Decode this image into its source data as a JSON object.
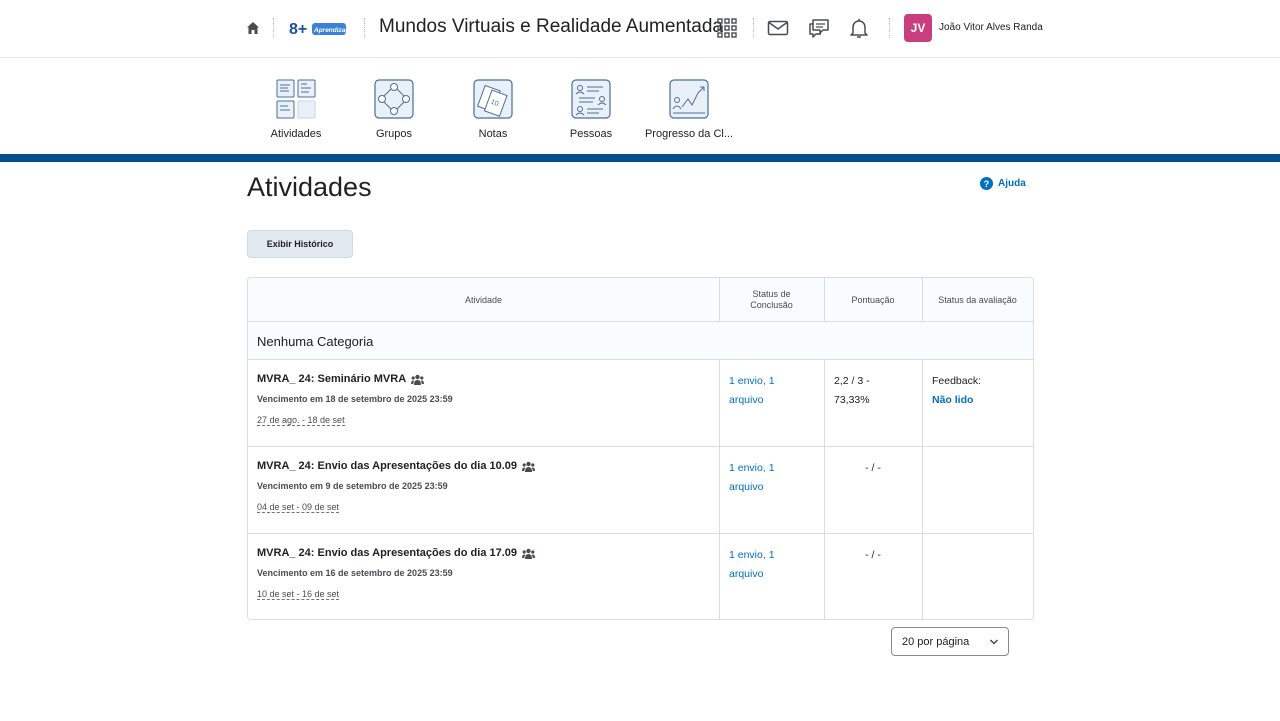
{
  "header": {
    "course_title": "Mundos Virtuais e Realidade Aumentada",
    "logo_text": "8+ Aprendizagem",
    "avatar_initials": "JV",
    "avatar_color": "#c83e7f",
    "user_name": "João Vitor Alves Randa",
    "icons": [
      "home-icon",
      "apps-grid-icon",
      "mail-icon",
      "chat-icon",
      "bell-icon"
    ]
  },
  "nav": {
    "items": [
      {
        "label": "Atividades",
        "icon": "activities-icon"
      },
      {
        "label": "Grupos",
        "icon": "groups-icon"
      },
      {
        "label": "Notas",
        "icon": "grades-icon"
      },
      {
        "label": "Pessoas",
        "icon": "people-icon"
      },
      {
        "label": "Progresso da Cl...",
        "icon": "progress-icon"
      }
    ]
  },
  "page": {
    "title": "Atividades",
    "help_label": "Ajuda",
    "history_button": "Exibir Histórico"
  },
  "table": {
    "headers": {
      "activity": "Atividade",
      "completion": "Status de Conclusão",
      "score": "Pontuação",
      "evaluation": "Status da avaliação"
    },
    "category": "Nenhuma Categoria",
    "rows": [
      {
        "name": "MVRA_ 24: Seminário MVRA",
        "due": "Vencimento em 18 de setembro de 2025 23:59",
        "dates": "27 de ago. - 18 de set",
        "status_line1": "1 envio, 1",
        "status_line2": "arquivo",
        "score_line1": "2,2 / 3 -",
        "score_line2": "73,33%",
        "feedback_label": "Feedback:",
        "feedback_status": "Não lido"
      },
      {
        "name": "MVRA_ 24: Envio das Apresentações do dia 10.09",
        "due": "Vencimento em 9 de setembro de 2025 23:59",
        "dates": "04 de set - 09 de set",
        "status_line1": "1 envio, 1",
        "status_line2": "arquivo",
        "score_line1": "- / -"
      },
      {
        "name": "MVRA_ 24: Envio das Apresentações do dia 17.09",
        "due": "Vencimento em 16 de setembro de 2025 23:59",
        "dates": "10 de set - 16 de set",
        "status_line1": "1 envio, 1",
        "status_line2": "arquivo",
        "score_line1": "- / -"
      }
    ]
  },
  "pagination": {
    "per_page": "20 por página"
  },
  "colors": {
    "accent_blue": "#006fbf",
    "stripe_blue": "#00508e"
  }
}
